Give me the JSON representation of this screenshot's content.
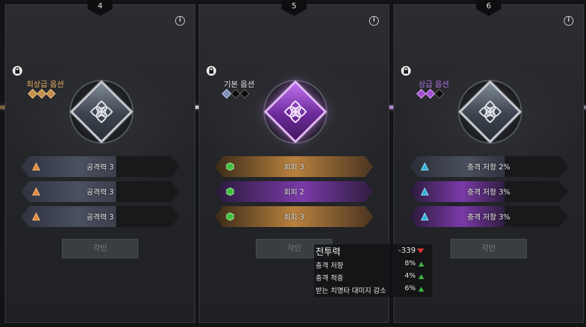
{
  "colors": {
    "gold_accent": "#e8b060",
    "purple_accent": "#b070e0",
    "white_label": "#d8d8d8",
    "stat_down": "#e03434",
    "stat_up": "#3fb43f"
  },
  "panels": [
    {
      "number": "4",
      "option_title": "최상급 옵션",
      "gems": [
        "gold",
        "gold",
        "gold"
      ],
      "emblem": "silver",
      "slots": [
        {
          "label": "공격력 3",
          "style": "gray",
          "fill": 0.6,
          "icon": "triangle-orange-icon"
        },
        {
          "label": "공격력 3",
          "style": "gray",
          "fill": 0.6,
          "icon": "triangle-orange-icon"
        },
        {
          "label": "공격력 3",
          "style": "gray",
          "fill": 0.6,
          "icon": "triangle-orange-icon"
        }
      ],
      "button": "각인"
    },
    {
      "number": "5",
      "option_title": "기본 옵션",
      "gems": [
        "blue",
        "dark",
        "dark"
      ],
      "emblem": "purple",
      "slots": [
        {
          "label": "회피 3",
          "style": "orange",
          "fill": 1.0,
          "icon": "hexagon-green-icon"
        },
        {
          "label": "회피 2",
          "style": "purple",
          "fill": 1.0,
          "icon": "hexagon-green-icon"
        },
        {
          "label": "회피 3",
          "style": "orange",
          "fill": 1.0,
          "icon": "hexagon-green-icon"
        }
      ],
      "button": "각인"
    },
    {
      "number": "6",
      "option_title": "상급 옵션",
      "gems": [
        "purple",
        "purple",
        "dark"
      ],
      "emblem": "silver",
      "slots": [
        {
          "label": "충격 저항 2%",
          "style": "blue",
          "fill": 0.6,
          "icon": "triangle-cyan-icon"
        },
        {
          "label": "충격 저항 3%",
          "style": "purple",
          "fill": 0.6,
          "icon": "triangle-cyan-icon"
        },
        {
          "label": "충격 저항 3%",
          "style": "purple",
          "fill": 0.6,
          "icon": "triangle-cyan-icon"
        }
      ],
      "button": "각인"
    }
  ],
  "tooltip": {
    "rows": [
      {
        "label": "전투력",
        "value": "-339",
        "trend": "down"
      },
      {
        "label": "충격 저항",
        "value": "8%",
        "trend": "up"
      },
      {
        "label": "충격 적중",
        "value": "4%",
        "trend": "up"
      },
      {
        "label": "받는 치명타 대미지 감소",
        "value": "6%",
        "trend": "up"
      }
    ]
  }
}
